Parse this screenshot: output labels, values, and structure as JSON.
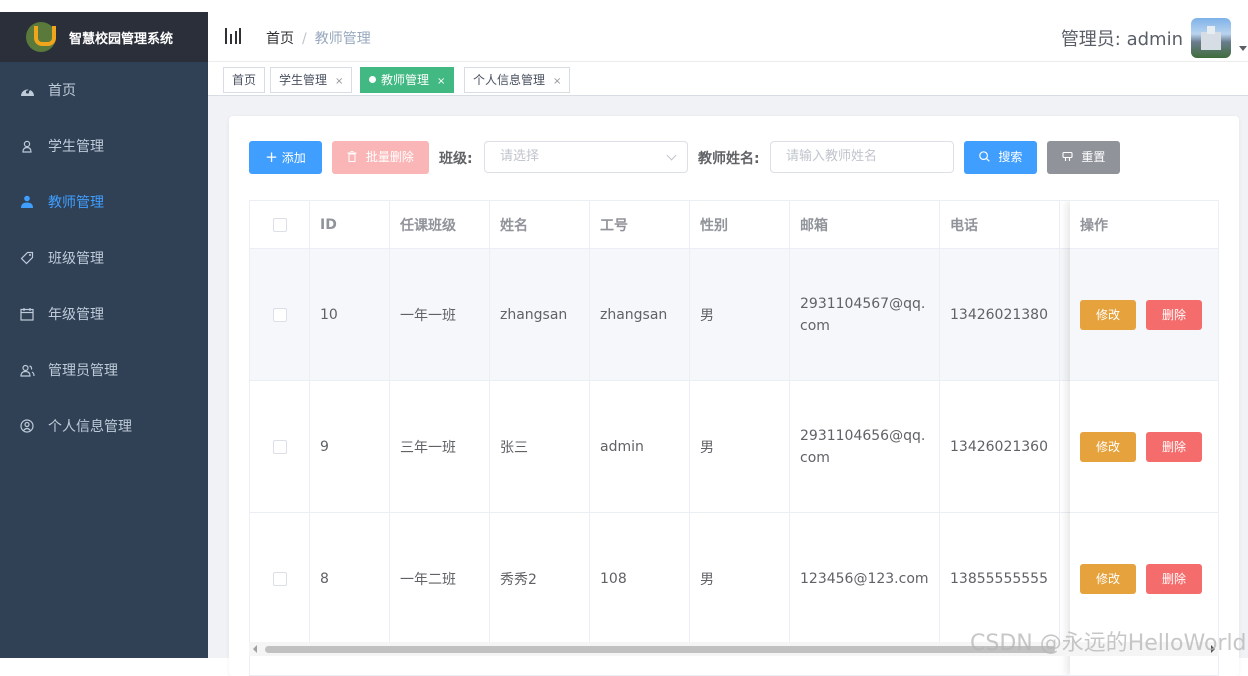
{
  "app": {
    "title": "智慧校园管理系统"
  },
  "sidebar": {
    "items": [
      {
        "label": "首页",
        "icon": "dashboard-icon",
        "active": false
      },
      {
        "label": "学生管理",
        "icon": "user-icon",
        "active": false
      },
      {
        "label": "教师管理",
        "icon": "users-icon",
        "active": true
      },
      {
        "label": "班级管理",
        "icon": "tag-icon",
        "active": false
      },
      {
        "label": "年级管理",
        "icon": "calendar-icon",
        "active": false
      },
      {
        "label": "管理员管理",
        "icon": "admin-group-icon",
        "active": false
      },
      {
        "label": "个人信息管理",
        "icon": "profile-icon",
        "active": false
      }
    ]
  },
  "header": {
    "breadcrumb": [
      "首页",
      "教师管理"
    ],
    "breadcrumb_sep": "/",
    "user_label": "管理员: admin"
  },
  "tags": [
    {
      "label": "首页",
      "closable": false,
      "active": false
    },
    {
      "label": "学生管理",
      "closable": true,
      "active": false
    },
    {
      "label": "教师管理",
      "closable": true,
      "active": true
    },
    {
      "label": "个人信息管理",
      "closable": true,
      "active": false
    }
  ],
  "tag_close_glyph": "×",
  "toolbar": {
    "add_label": "添加",
    "batch_delete_label": "批量删除",
    "class_label": "班级:",
    "class_placeholder": "请选择",
    "teacher_name_label": "教师姓名:",
    "teacher_name_placeholder": "请输入教师姓名",
    "search_label": "搜索",
    "reset_label": "重置"
  },
  "table": {
    "columns": [
      "ID",
      "任课班级",
      "姓名",
      "工号",
      "性别",
      "邮箱",
      "电话",
      "操作"
    ],
    "rows": [
      {
        "id": "10",
        "class": "一年一班",
        "name": "zhangsan",
        "job_no": "zhangsan",
        "gender": "男",
        "email": "2931104567@qq.com",
        "phone": "13426021380"
      },
      {
        "id": "9",
        "class": "三年一班",
        "name": "张三",
        "job_no": "admin",
        "gender": "男",
        "email": "2931104656@qq.com",
        "phone": "13426021360"
      },
      {
        "id": "8",
        "class": "一年二班",
        "name": "秀秀2",
        "job_no": "108",
        "gender": "男",
        "email": "123456@123.com",
        "phone": "13855555555"
      }
    ],
    "edit_label": "修改",
    "delete_label": "删除"
  },
  "watermark": "CSDN @永远的HelloWorld",
  "colors": {
    "sidebar_bg": "#304156",
    "primary": "#409eff",
    "active_tag": "#42b983",
    "warning": "#e6a23c",
    "danger": "#f56c6c"
  }
}
